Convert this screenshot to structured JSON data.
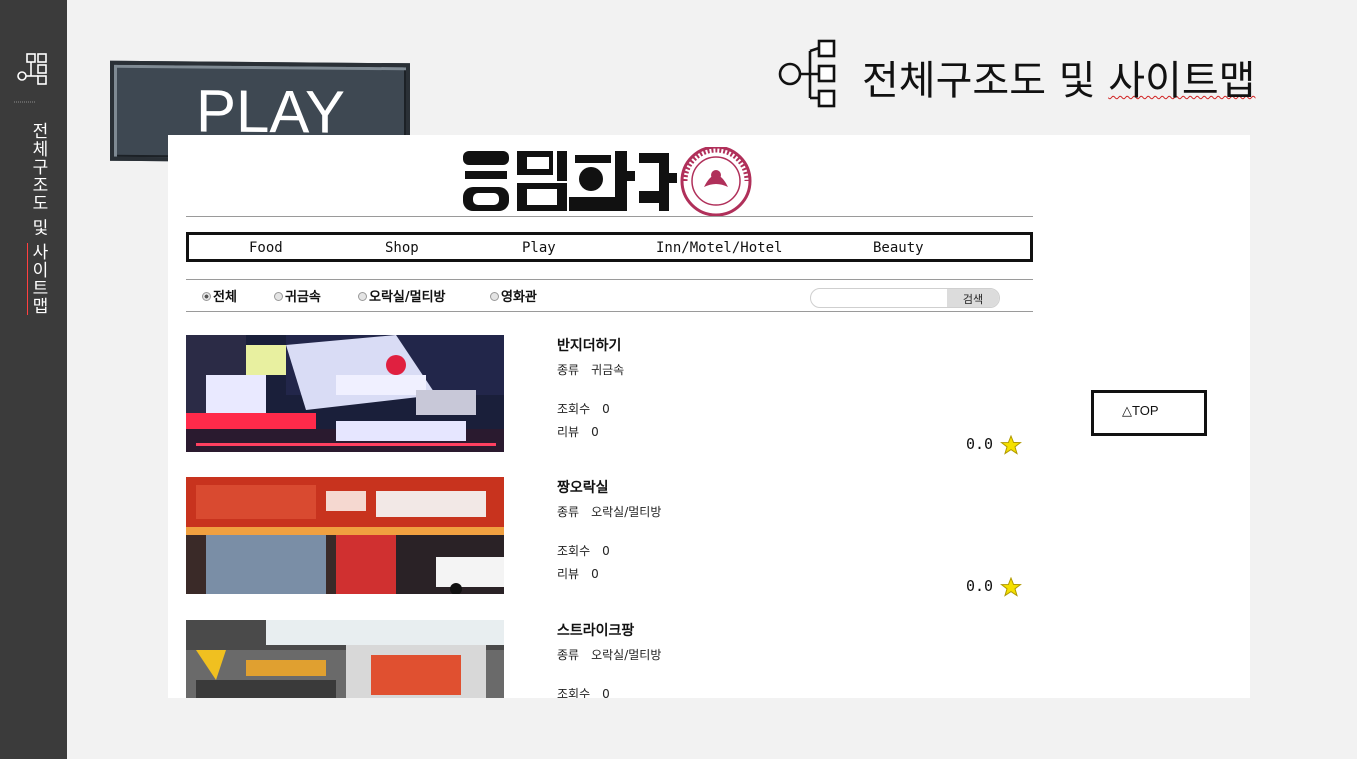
{
  "sidebar": {
    "label": "전체구조도 및 ",
    "label_underlined": "사이트맵"
  },
  "badge": {
    "text": "PLAY"
  },
  "slide_title": {
    "text": "전체구조도 및 ",
    "text_underlined": "사이트맵"
  },
  "site": {
    "nav": [
      "Food",
      "Shop",
      "Play",
      "Inn/Motel/Hotel",
      "Beauty"
    ],
    "filters": [
      {
        "label": "전체",
        "selected": true
      },
      {
        "label": "귀금속",
        "selected": false
      },
      {
        "label": "오락실/멀티방",
        "selected": false
      },
      {
        "label": "영화관",
        "selected": false
      }
    ],
    "search": {
      "value": "",
      "button": "검색"
    },
    "labels": {
      "type": "종류",
      "views": "조회수",
      "reviews": "리뷰"
    },
    "items": [
      {
        "name": "반지더하기",
        "type": "귀금속",
        "views": "0",
        "reviews": "0",
        "rating": "0.0"
      },
      {
        "name": "짱오락실",
        "type": "오락실/멀티방",
        "views": "0",
        "reviews": "0",
        "rating": "0.0"
      },
      {
        "name": "스트라이크팡",
        "type": "오락실/멀티방",
        "views": "0"
      }
    ],
    "top_button": "△TOP"
  },
  "colors": {
    "sidebar": "#3b3b3b",
    "badge": "#3e4852",
    "star": "#f5e000",
    "logo_seal": "#b0305a"
  }
}
